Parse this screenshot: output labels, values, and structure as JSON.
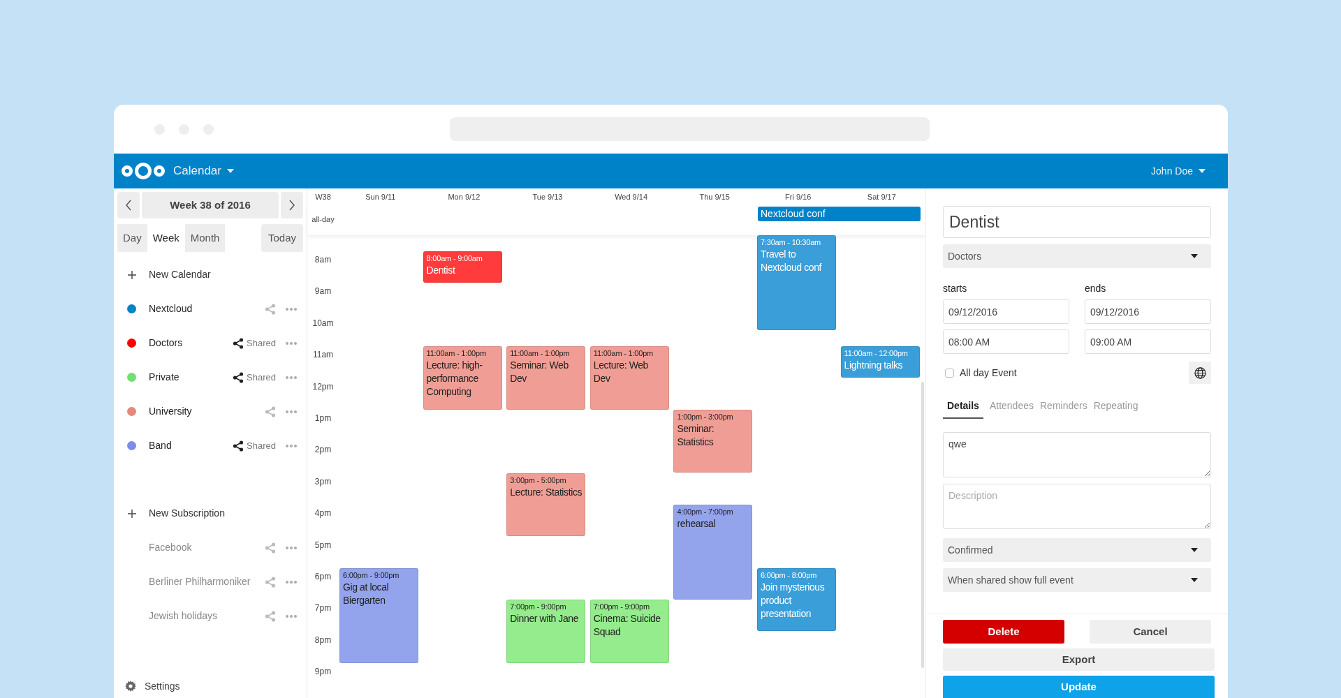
{
  "header": {
    "app": "Calendar",
    "user": "John Doe"
  },
  "sidebar": {
    "week_title": "Week 38 of 2016",
    "views": [
      {
        "label": "Day",
        "selected": false
      },
      {
        "label": "Week",
        "selected": true
      },
      {
        "label": "Month",
        "selected": false
      }
    ],
    "today": "Today",
    "new_calendar": "New Calendar",
    "calendars": [
      {
        "name": "Nextcloud",
        "color": "#0082c9",
        "shared": false
      },
      {
        "name": "Doctors",
        "color": "#ff0000",
        "shared": true,
        "share_label": "Shared"
      },
      {
        "name": "Private",
        "color": "#70e070",
        "shared": true,
        "share_label": "Shared"
      },
      {
        "name": "University",
        "color": "#e9877b",
        "shared": false
      },
      {
        "name": "Band",
        "color": "#7b8cec",
        "shared": true,
        "share_label": "Shared"
      }
    ],
    "new_subscription": "New Subscription",
    "subscriptions": [
      {
        "name": "Facebook"
      },
      {
        "name": "Berliner Philharmoniker"
      },
      {
        "name": "Jewish holidays"
      }
    ],
    "settings": "Settings"
  },
  "calendar": {
    "week": "W38",
    "allday_label": "all-day",
    "allday_events": [
      {
        "title": "Nextcloud conf",
        "color": "#0082c9"
      }
    ],
    "hours": [
      "8am",
      "9am",
      "10am",
      "11am",
      "12pm",
      "1pm",
      "2pm",
      "3pm",
      "4pm",
      "5pm",
      "6pm",
      "7pm",
      "8pm",
      "9pm"
    ],
    "days": [
      {
        "label": "Sun 9/11",
        "events": [
          {
            "time": "6:00pm - 9:00pm",
            "title": "Gig at local Biergarten",
            "color": "#93a3ec"
          }
        ]
      },
      {
        "label": "Mon 9/12",
        "events": [
          {
            "time": "8:00am - 9:00am",
            "title": "Dentist",
            "color": "#ff3b3b"
          },
          {
            "time": "11:00am - 1:00pm",
            "title": "Lecture: high-performance Computing",
            "color": "#f09e95"
          }
        ]
      },
      {
        "label": "Tue 9/13",
        "events": [
          {
            "time": "11:00am - 1:00pm",
            "title": "Seminar: Web Dev",
            "color": "#f09e95"
          },
          {
            "time": "3:00pm - 5:00pm",
            "title": "Lecture: Statistics",
            "color": "#f09e95"
          },
          {
            "time": "7:00pm - 9:00pm",
            "title": "Dinner with Jane",
            "color": "#94ec8c"
          }
        ]
      },
      {
        "label": "Wed 9/14",
        "events": [
          {
            "time": "11:00am - 1:00pm",
            "title": "Lecture: Web Dev",
            "color": "#f09e95"
          },
          {
            "time": "7:00pm - 9:00pm",
            "title": "Cinema: Suicide Squad",
            "color": "#94ec8c"
          }
        ]
      },
      {
        "label": "Thu 9/15",
        "events": [
          {
            "time": "1:00pm - 3:00pm",
            "title": "Seminar: Statistics",
            "color": "#f09e95"
          },
          {
            "time": "4:00pm - 7:00pm",
            "title": "rehearsal",
            "color": "#93a3ec"
          }
        ]
      },
      {
        "label": "Fri 9/16",
        "events": [
          {
            "time": "7:30am - 10:30am",
            "title": "Travel to Nextcloud conf",
            "color": "#3a9ed9"
          },
          {
            "time": "6:00pm - 8:00pm",
            "title": "Join mysterious product presentation",
            "color": "#3a9ed9"
          }
        ]
      },
      {
        "label": "Sat 9/17",
        "events": [
          {
            "time": "11:00am - 12:00pm",
            "title": "Lightning talks",
            "color": "#3a9ed9"
          }
        ]
      }
    ]
  },
  "editor": {
    "title": "Dentist",
    "calendar": "Doctors",
    "starts_label": "starts",
    "ends_label": "ends",
    "start_date": "09/12/2016",
    "end_date": "09/12/2016",
    "start_time": "08:00 AM",
    "end_time": "09:00 AM",
    "all_day": {
      "label": "All day Event",
      "checked": false
    },
    "tabs": [
      {
        "label": "Details",
        "selected": true
      },
      {
        "label": "Attendees",
        "selected": false
      },
      {
        "label": "Reminders",
        "selected": false
      },
      {
        "label": "Repeating",
        "selected": false
      }
    ],
    "location": "qwe",
    "description_placeholder": "Description",
    "status": "Confirmed",
    "visibility": "When shared show full event",
    "buttons": {
      "delete": "Delete",
      "cancel": "Cancel",
      "export": "Export",
      "update": "Update"
    }
  }
}
